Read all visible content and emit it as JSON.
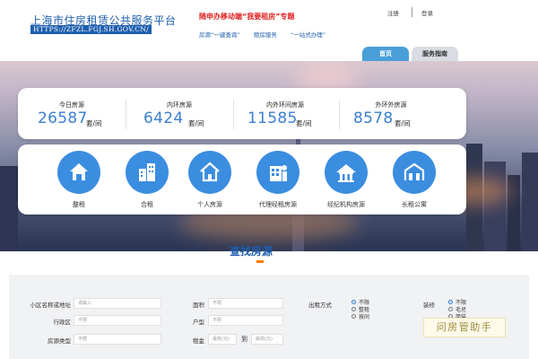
{
  "header": {
    "site_title": "上海市住房租赁公共服务平台",
    "site_url": "HTTPS://ZFZL.FGJ.SH.GOV.CN/",
    "promo": "随申办移动端“我要租房”专题",
    "links": [
      "房源“一键查询”",
      "租房服务",
      "“一站式办理”"
    ],
    "register": "注册",
    "login": "登录",
    "nav": [
      {
        "label": "首页",
        "active": true
      },
      {
        "label": "服务指南",
        "active": false
      }
    ]
  },
  "stats": [
    {
      "label": "今日房源",
      "value": "26587",
      "unit": "套/间"
    },
    {
      "label": "内环房源",
      "value": "6424",
      "unit": "套/间"
    },
    {
      "label": "内外环间房源",
      "value": "11585",
      "unit": "套/间"
    },
    {
      "label": "外环外房源",
      "value": "8578",
      "unit": "套/间"
    }
  ],
  "categories": [
    {
      "label": "整租",
      "icon": "house-icon"
    },
    {
      "label": "合租",
      "icon": "buildings-icon"
    },
    {
      "label": "个人房源",
      "icon": "home-outline-icon"
    },
    {
      "label": "代理经租房源",
      "icon": "agent-building-icon"
    },
    {
      "label": "经纪机构房源",
      "icon": "agency-icon"
    },
    {
      "label": "长租公寓",
      "icon": "apartment-icon"
    }
  ],
  "search": {
    "title": "查找房源",
    "fields": {
      "community": {
        "label": "小区名称或地址",
        "placeholder": "请输入"
      },
      "district": {
        "label": "行政区",
        "placeholder": "不限"
      },
      "house_type": {
        "label": "房源类型",
        "placeholder": "不限"
      },
      "area": {
        "label": "面积",
        "placeholder": "不限"
      },
      "layout": {
        "label": "户型",
        "placeholder": "不限"
      },
      "rent": {
        "label": "租金",
        "min_placeholder": "最低(元)",
        "to": "到",
        "max_placeholder": "最高(元)"
      }
    },
    "rent_mode": {
      "label": "出租方式",
      "options": [
        "不限",
        "整租",
        "按间"
      ],
      "selected": "不限"
    },
    "decoration": {
      "label": "装修",
      "options": [
        "不限",
        "毛坯",
        "简装"
      ],
      "selected": "不限"
    }
  },
  "watermark": "问房管助手",
  "colors": {
    "brand_blue": "#1f5fae",
    "accent_blue": "#3b8de0",
    "promo_red": "#e02020"
  }
}
